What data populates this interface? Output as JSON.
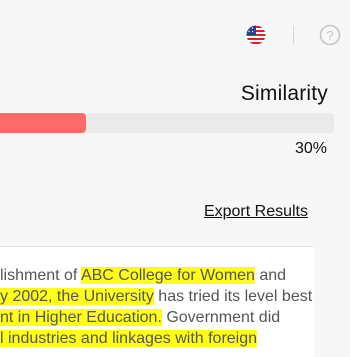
{
  "header": {
    "flag_icon": "us-flag-icon",
    "help_icon": "question-circle-icon"
  },
  "similarity": {
    "title": "Similarity",
    "percent_text": "30%",
    "value": 0.3,
    "fill_color": "#ff6b6b"
  },
  "export": {
    "label": "Export Results"
  },
  "text": {
    "lines": [
      [
        {
          "t": "lishment of ",
          "h": false
        },
        {
          "t": "ABC College for Women",
          "h": true
        },
        {
          "t": " and",
          "h": false
        }
      ],
      [
        {
          "t": "y 2002, the University",
          "h": true
        },
        {
          "t": " has tried its level best",
          "h": false
        }
      ],
      [
        {
          "t": "nt in Higher Education.",
          "h": true
        },
        {
          "t": " Government did",
          "h": false
        }
      ],
      [
        {
          "t": "l industries and linkages with foreign",
          "h": true
        }
      ]
    ],
    "highlight_color": "#ffff1a"
  }
}
